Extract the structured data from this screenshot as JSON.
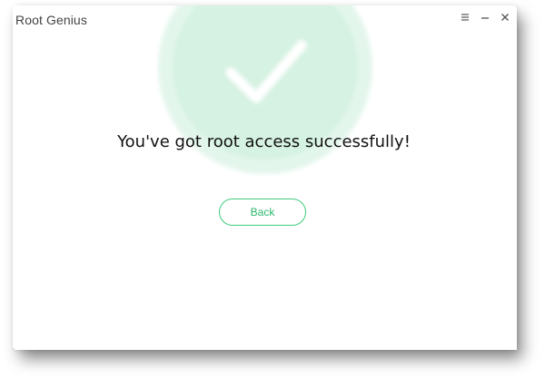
{
  "window": {
    "title": "Root Genius"
  },
  "controls": {
    "menu_icon": "menu-icon",
    "minimize_icon": "minimize-icon",
    "close_icon": "close-icon"
  },
  "main": {
    "message": "You've got root access successfully!",
    "back_label": "Back"
  },
  "colors": {
    "accent": "#3ecb7e",
    "check_bg": "#d9f3e6",
    "text": "#111111"
  }
}
